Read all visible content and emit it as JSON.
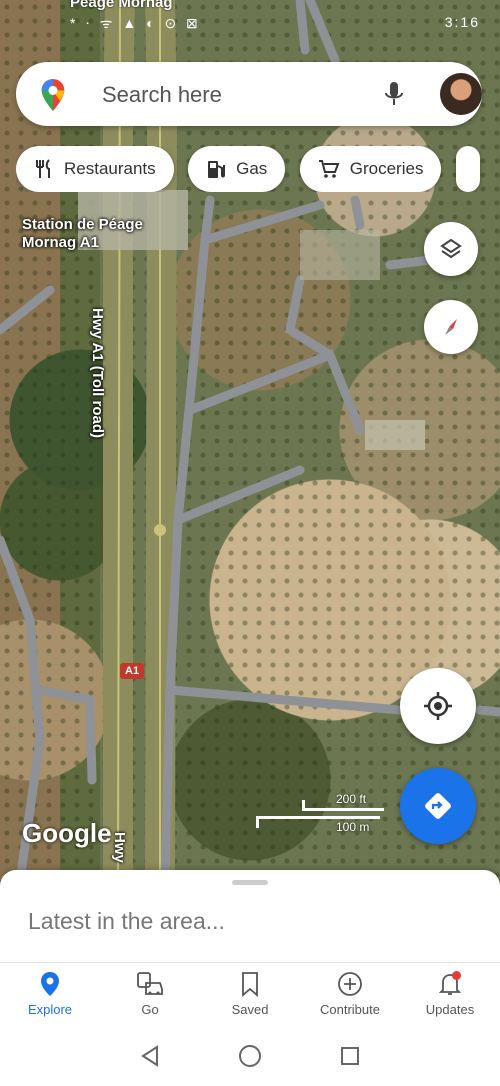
{
  "status_bar": {
    "notification_text": "Peage Mornag",
    "left_icons": "* ⋅ ᯤ ▲ ◐ ⊙ ⊠",
    "time": "3:16"
  },
  "search": {
    "placeholder": "Search here"
  },
  "chips": [
    {
      "label": "Restaurants",
      "icon": "fork-knife-icon"
    },
    {
      "label": "Gas",
      "icon": "gas-pump-icon"
    },
    {
      "label": "Groceries",
      "icon": "cart-icon"
    }
  ],
  "map": {
    "station_label_line1": "Station de Péage",
    "station_label_line2": "Mornag A1",
    "highway_label": "Hwy A1 (Toll road)",
    "highway_label_bottom": "Hwy",
    "route_badge": "A1",
    "attribution": "Google",
    "scale_top": "200 ft",
    "scale_bottom": "100 m"
  },
  "sheet": {
    "title": "Latest in the area..."
  },
  "bottom_nav": [
    {
      "label": "Explore",
      "icon": "explore-pin-icon",
      "active": true
    },
    {
      "label": "Go",
      "icon": "commute-icon",
      "active": false
    },
    {
      "label": "Saved",
      "icon": "bookmark-icon",
      "active": false
    },
    {
      "label": "Contribute",
      "icon": "add-circle-icon",
      "active": false
    },
    {
      "label": "Updates",
      "icon": "bell-icon",
      "active": false
    }
  ],
  "colors": {
    "accent": "#1a73e8",
    "badge": "#e53935"
  }
}
